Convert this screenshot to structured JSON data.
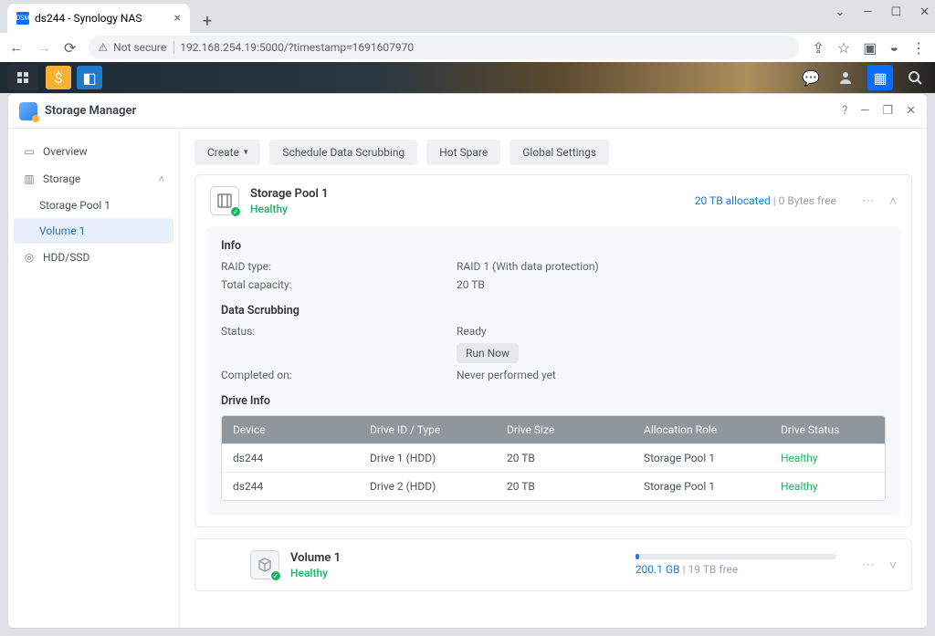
{
  "browser": {
    "tab_title": "ds244 - Synology NAS",
    "not_secure_label": "Not secure",
    "url": "192.168.254.19:5000/?timestamp=1691607970"
  },
  "window": {
    "title": "Storage Manager"
  },
  "sidebar": {
    "overview_label": "Overview",
    "storage_label": "Storage",
    "storage_pool_label": "Storage Pool 1",
    "volume_label": "Volume 1",
    "hdd_label": "HDD/SSD"
  },
  "toolbar": {
    "create_label": "Create",
    "scrub_label": "Schedule Data Scrubbing",
    "hotspare_label": "Hot Spare",
    "global_label": "Global Settings"
  },
  "pool": {
    "title": "Storage Pool 1",
    "health": "Healthy",
    "allocated": "20 TB allocated",
    "free": "0 Bytes free",
    "info_heading": "Info",
    "raid_label": "RAID type:",
    "raid_value": "RAID 1 (With data protection)",
    "capacity_label": "Total capacity:",
    "capacity_value": "20 TB",
    "scrub_heading": "Data Scrubbing",
    "status_label": "Status:",
    "status_value": "Ready",
    "run_now_label": "Run Now",
    "completed_label": "Completed on:",
    "completed_value": "Never performed yet",
    "drive_heading": "Drive Info",
    "table": {
      "headers": {
        "device": "Device",
        "id": "Drive ID / Type",
        "size": "Drive Size",
        "role": "Allocation Role",
        "status": "Drive Status"
      },
      "rows": [
        {
          "device": "ds244",
          "id": "Drive 1 (HDD)",
          "size": "20 TB",
          "role": "Storage Pool 1",
          "status": "Healthy"
        },
        {
          "device": "ds244",
          "id": "Drive 2 (HDD)",
          "size": "20 TB",
          "role": "Storage Pool 1",
          "status": "Healthy"
        }
      ]
    }
  },
  "volume": {
    "title": "Volume 1",
    "health": "Healthy",
    "used": "200.1 GB",
    "free": "19 TB free"
  }
}
